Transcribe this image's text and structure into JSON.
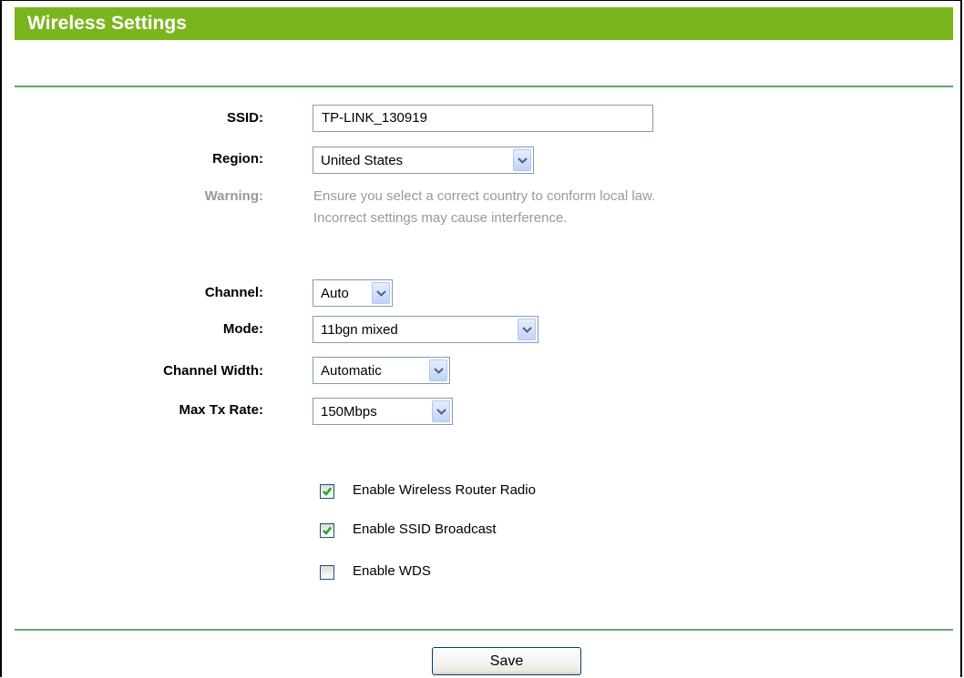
{
  "title": "Wireless Settings",
  "form": {
    "ssid": {
      "label": "SSID:",
      "value": "TP-LINK_130919"
    },
    "region": {
      "label": "Region:",
      "value": "United States"
    },
    "warning": {
      "label": "Warning:",
      "line1": "Ensure you select a correct country to conform local law.",
      "line2": "Incorrect settings may cause interference."
    },
    "channel": {
      "label": "Channel:",
      "value": "Auto"
    },
    "mode": {
      "label": "Mode:",
      "value": "11bgn mixed"
    },
    "channel_width": {
      "label": "Channel Width:",
      "value": "Automatic"
    },
    "max_tx_rate": {
      "label": "Max Tx Rate:",
      "value": "150Mbps"
    }
  },
  "options": [
    {
      "label": "Enable Wireless Router Radio",
      "checked": true
    },
    {
      "label": "Enable SSID Broadcast",
      "checked": true
    },
    {
      "label": "Enable WDS",
      "checked": false
    }
  ],
  "actions": {
    "save_label": "Save"
  },
  "colors": {
    "title_bar": "#7bb51e",
    "divider": "#5fa76c",
    "checkmark": "#21a121",
    "muted_text": "#999999"
  },
  "icons": {
    "dropdown": "chevron-down-icon",
    "checked": "checkmark-icon"
  }
}
